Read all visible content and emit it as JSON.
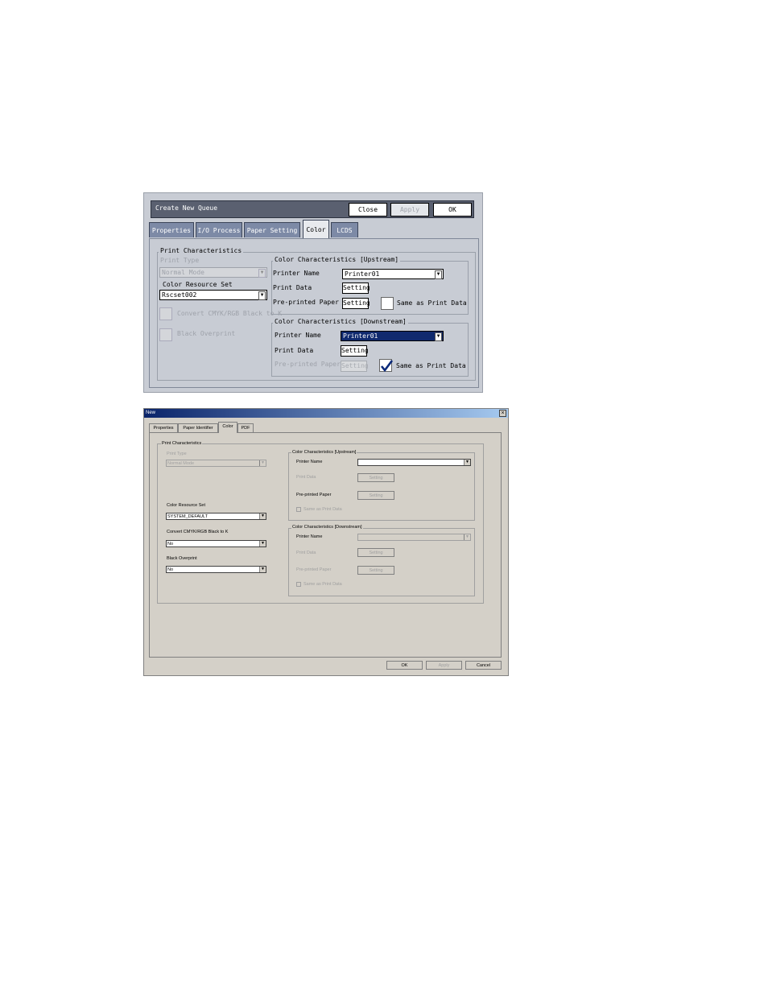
{
  "dialog1": {
    "title": "Create New Queue",
    "buttons": {
      "close": "Close",
      "apply": "Apply",
      "ok": "OK"
    },
    "tabs": [
      "Properties",
      "I/O Process",
      "Paper Setting",
      "Color",
      "LCDS"
    ],
    "print_characteristics": {
      "title": "Print Characteristics",
      "print_type_label": "Print Type",
      "print_type_value": "Normal Mode",
      "color_resource_set_label": "Color Resource Set",
      "color_resource_set_value": "Rscset002",
      "convert_label": "Convert CMYK/RGB Black to K",
      "black_overprint_label": "Black Overprint"
    },
    "upstream": {
      "title": "Color Characteristics  [Upstream]",
      "printer_name_label": "Printer Name",
      "printer_name_value": "Printer01",
      "print_data_label": "Print Data",
      "print_data_button": "Setting",
      "preprinted_label": "Pre-printed Paper",
      "preprinted_button": "Setting",
      "same_as_label": "Same as Print Data"
    },
    "downstream": {
      "title": "Color Characteristics  [Downstream]",
      "printer_name_label": "Printer Name",
      "printer_name_value": "Printer01",
      "print_data_label": "Print Data",
      "print_data_button": "Setting",
      "preprinted_label": "Pre-printed Paper",
      "preprinted_button": "Setting",
      "same_as_label": "Same as Print Data",
      "same_as_checked": true
    },
    "icons": {
      "dropdown": "chevron-down-icon",
      "check": "check-icon"
    }
  },
  "dialog2": {
    "title": "New",
    "close_glyph": "×",
    "tabs": [
      "Properties",
      "Paper Identifier",
      "Color",
      "PDF"
    ],
    "print_characteristics": {
      "title": "Print Characteristics",
      "print_type_label": "Print Type",
      "print_type_value": "Normal Mode",
      "color_resource_set_label": "Color Resource Set",
      "color_resource_set_value": "SYSTEM_DEFAULT",
      "convert_label": "Convert CMYK/RGB Black to K",
      "convert_value": "No",
      "black_overprint_label": "Black Overprint",
      "black_overprint_value": "No"
    },
    "upstream": {
      "title": "Color Characteristics [Upstream]",
      "printer_name_label": "Printer Name",
      "printer_name_value": "",
      "print_data_label": "Print Data",
      "print_data_button": "Setting",
      "preprinted_label": "Pre-printed Paper",
      "preprinted_button": "Setting",
      "same_as_label": "Same as Print Data"
    },
    "downstream": {
      "title": "Color Characteristics [Downstream]",
      "printer_name_label": "Printer Name",
      "printer_name_value": "",
      "print_data_label": "Print Data",
      "print_data_button": "Setting",
      "preprinted_label": "Pre-printed Paper",
      "preprinted_button": "Setting",
      "same_as_label": "Same as Print Data"
    },
    "buttons": {
      "ok": "OK",
      "apply": "Apply",
      "cancel": "Cancel"
    }
  }
}
